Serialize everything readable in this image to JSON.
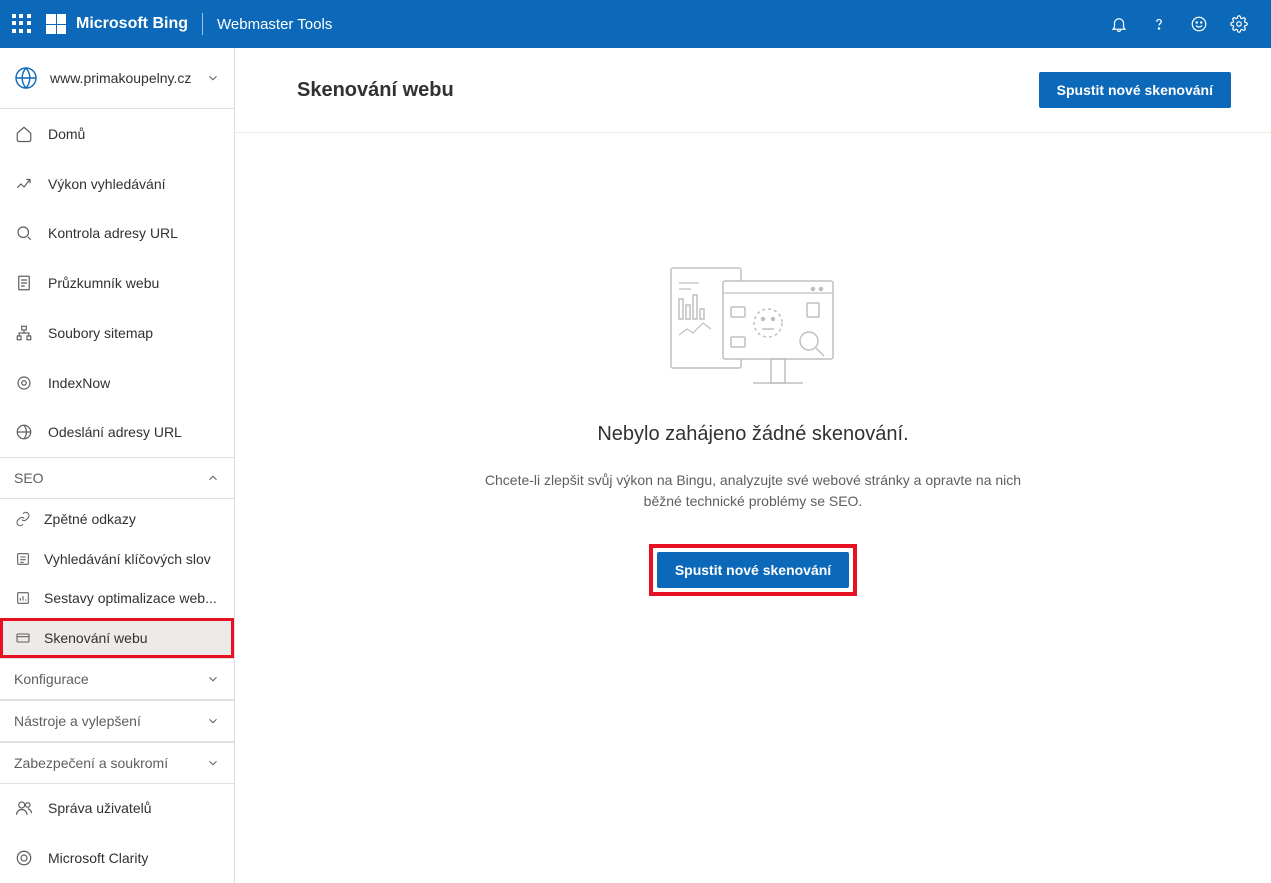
{
  "header": {
    "brand": "Microsoft Bing",
    "product": "Webmaster Tools"
  },
  "site_selector": {
    "site": "www.primakoupelny.cz"
  },
  "sidebar": {
    "items": [
      {
        "label": "Domů"
      },
      {
        "label": "Výkon vyhledávání"
      },
      {
        "label": "Kontrola adresy URL"
      },
      {
        "label": "Průzkumník webu"
      },
      {
        "label": "Soubory sitemap"
      },
      {
        "label": "IndexNow"
      },
      {
        "label": "Odeslání adresy URL"
      }
    ],
    "sections": {
      "seo": {
        "label": "SEO"
      },
      "konfigurace": {
        "label": "Konfigurace"
      },
      "nastroje": {
        "label": "Nástroje a vylepšení"
      },
      "zabezpeceni": {
        "label": "Zabezpečení a soukromí"
      }
    },
    "seo_items": [
      {
        "label": "Zpětné odkazy"
      },
      {
        "label": "Vyhledávání klíčových slov"
      },
      {
        "label": "Sestavy optimalizace web..."
      },
      {
        "label": "Skenování webu"
      }
    ],
    "bottom_items": [
      {
        "label": "Správa uživatelů"
      },
      {
        "label": "Microsoft Clarity"
      }
    ]
  },
  "page": {
    "title": "Skenování webu",
    "header_button": "Spustit nové skenování",
    "empty_title": "Nebylo zahájeno žádné skenování.",
    "empty_desc": "Chcete-li zlepšit svůj výkon na Bingu, analyzujte své webové stránky a opravte na nich běžné technické problémy se SEO.",
    "cta_button": "Spustit nové skenování"
  }
}
